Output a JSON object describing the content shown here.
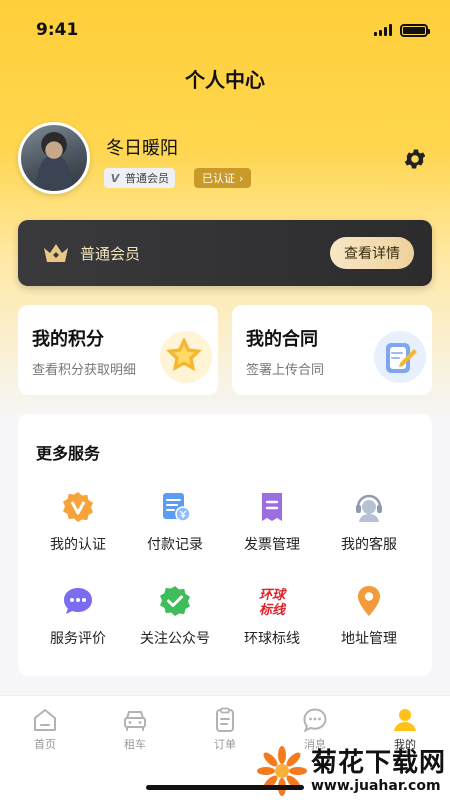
{
  "status_bar": {
    "time": "9:41"
  },
  "header": {
    "title": "个人中心"
  },
  "profile": {
    "name": "冬日暖阳",
    "member_level": "普通会员",
    "verified_label": "已认证",
    "verified_chevron": "›"
  },
  "vip_card": {
    "label": "普通会员",
    "detail_button": "查看详情"
  },
  "feature_cards": [
    {
      "title": "我的积分",
      "subtitle": "查看积分获取明细",
      "icon": "star-medal-icon"
    },
    {
      "title": "我的合同",
      "subtitle": "签署上传合同",
      "icon": "contract-sign-icon"
    }
  ],
  "services": {
    "title": "更多服务",
    "items": [
      {
        "label": "我的认证",
        "icon": "verify-badge-icon"
      },
      {
        "label": "付款记录",
        "icon": "payment-record-icon"
      },
      {
        "label": "发票管理",
        "icon": "invoice-icon"
      },
      {
        "label": "我的客服",
        "icon": "customer-service-icon"
      },
      {
        "label": "服务评价",
        "icon": "chat-rating-icon"
      },
      {
        "label": "关注公众号",
        "icon": "follow-check-icon"
      },
      {
        "label": "环球标线",
        "icon": "huanqiu-logo-icon",
        "logo_text": "环球标线"
      },
      {
        "label": "地址管理",
        "icon": "location-pin-icon"
      }
    ]
  },
  "tabbar": {
    "tabs": [
      {
        "label": "首页",
        "icon": "home-icon",
        "active": false
      },
      {
        "label": "租车",
        "icon": "car-icon",
        "active": false
      },
      {
        "label": "订单",
        "icon": "order-icon",
        "active": false
      },
      {
        "label": "消息",
        "icon": "message-icon",
        "active": false
      },
      {
        "label": "我的",
        "icon": "user-icon",
        "active": true
      }
    ]
  },
  "watermark": {
    "name": "菊花下载网",
    "url": "www.juahar.com"
  },
  "colors": {
    "brand_yellow": "#ffcf3a",
    "vip_dark": "#2c2c2e",
    "vip_gold": "#eed29e",
    "verified_gold": "#c9992a"
  }
}
